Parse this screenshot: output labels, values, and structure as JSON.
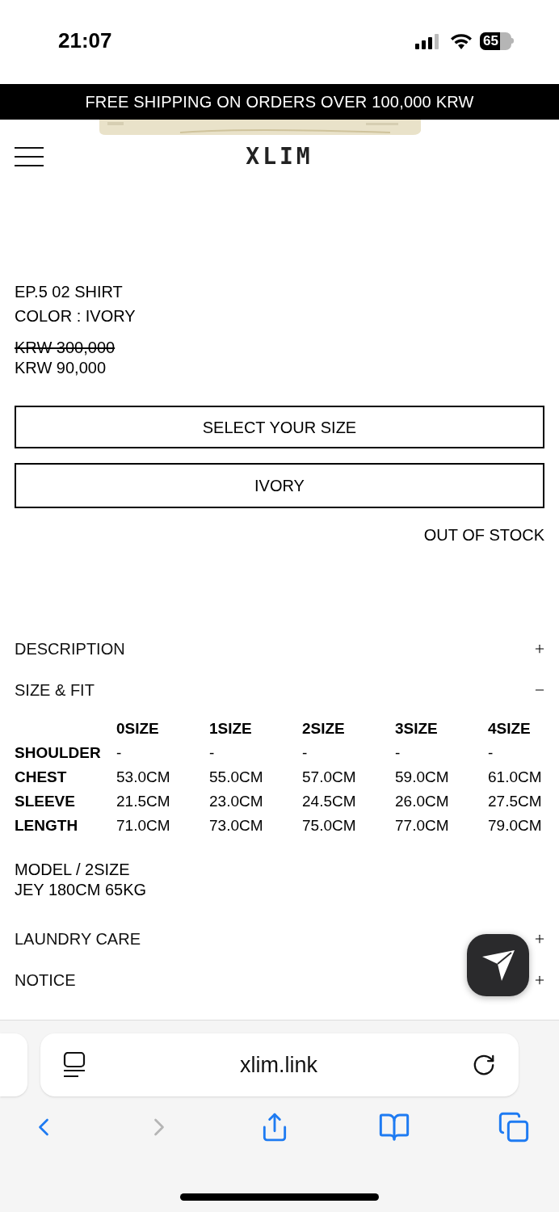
{
  "status_bar": {
    "time": "21:07",
    "battery": "65"
  },
  "banner": "FREE SHIPPING ON ORDERS OVER 100,000 KRW",
  "header": {
    "logo": "XLIM"
  },
  "product": {
    "name": "EP.5 02 SHIRT",
    "color_label": "COLOR : IVORY",
    "original_price": "KRW 300,000",
    "sale_price": "KRW 90,000"
  },
  "selects": [
    {
      "label": "SELECT YOUR SIZE"
    },
    {
      "label": "IVORY"
    }
  ],
  "stock_status": "OUT OF STOCK",
  "sections": [
    {
      "title": "DESCRIPTION",
      "expanded": false
    },
    {
      "title": "SIZE & FIT",
      "expanded": true
    }
  ],
  "size_table": {
    "columns": [
      "0SIZE",
      "1SIZE",
      "2SIZE",
      "3SIZE",
      "4SIZE"
    ],
    "rows": [
      {
        "label": "SHOULDER",
        "values": [
          "-",
          "-",
          "-",
          "-",
          "-"
        ]
      },
      {
        "label": "CHEST",
        "values": [
          "53.0CM",
          "55.0CM",
          "57.0CM",
          "59.0CM",
          "61.0CM"
        ]
      },
      {
        "label": "SLEEVE",
        "values": [
          "21.5CM",
          "23.0CM",
          "24.5CM",
          "26.0CM",
          "27.5CM"
        ]
      },
      {
        "label": "LENGTH",
        "values": [
          "71.0CM",
          "73.0CM",
          "75.0CM",
          "77.0CM",
          "79.0CM"
        ]
      }
    ]
  },
  "model_info": [
    "MODEL / 2SIZE",
    "JEY 180CM 65KG"
  ],
  "more_sections": [
    {
      "title": "LAUNDRY CARE",
      "expanded": false
    },
    {
      "title": "NOTICE",
      "expanded": false
    }
  ],
  "browser": {
    "url": "xlim.link"
  }
}
